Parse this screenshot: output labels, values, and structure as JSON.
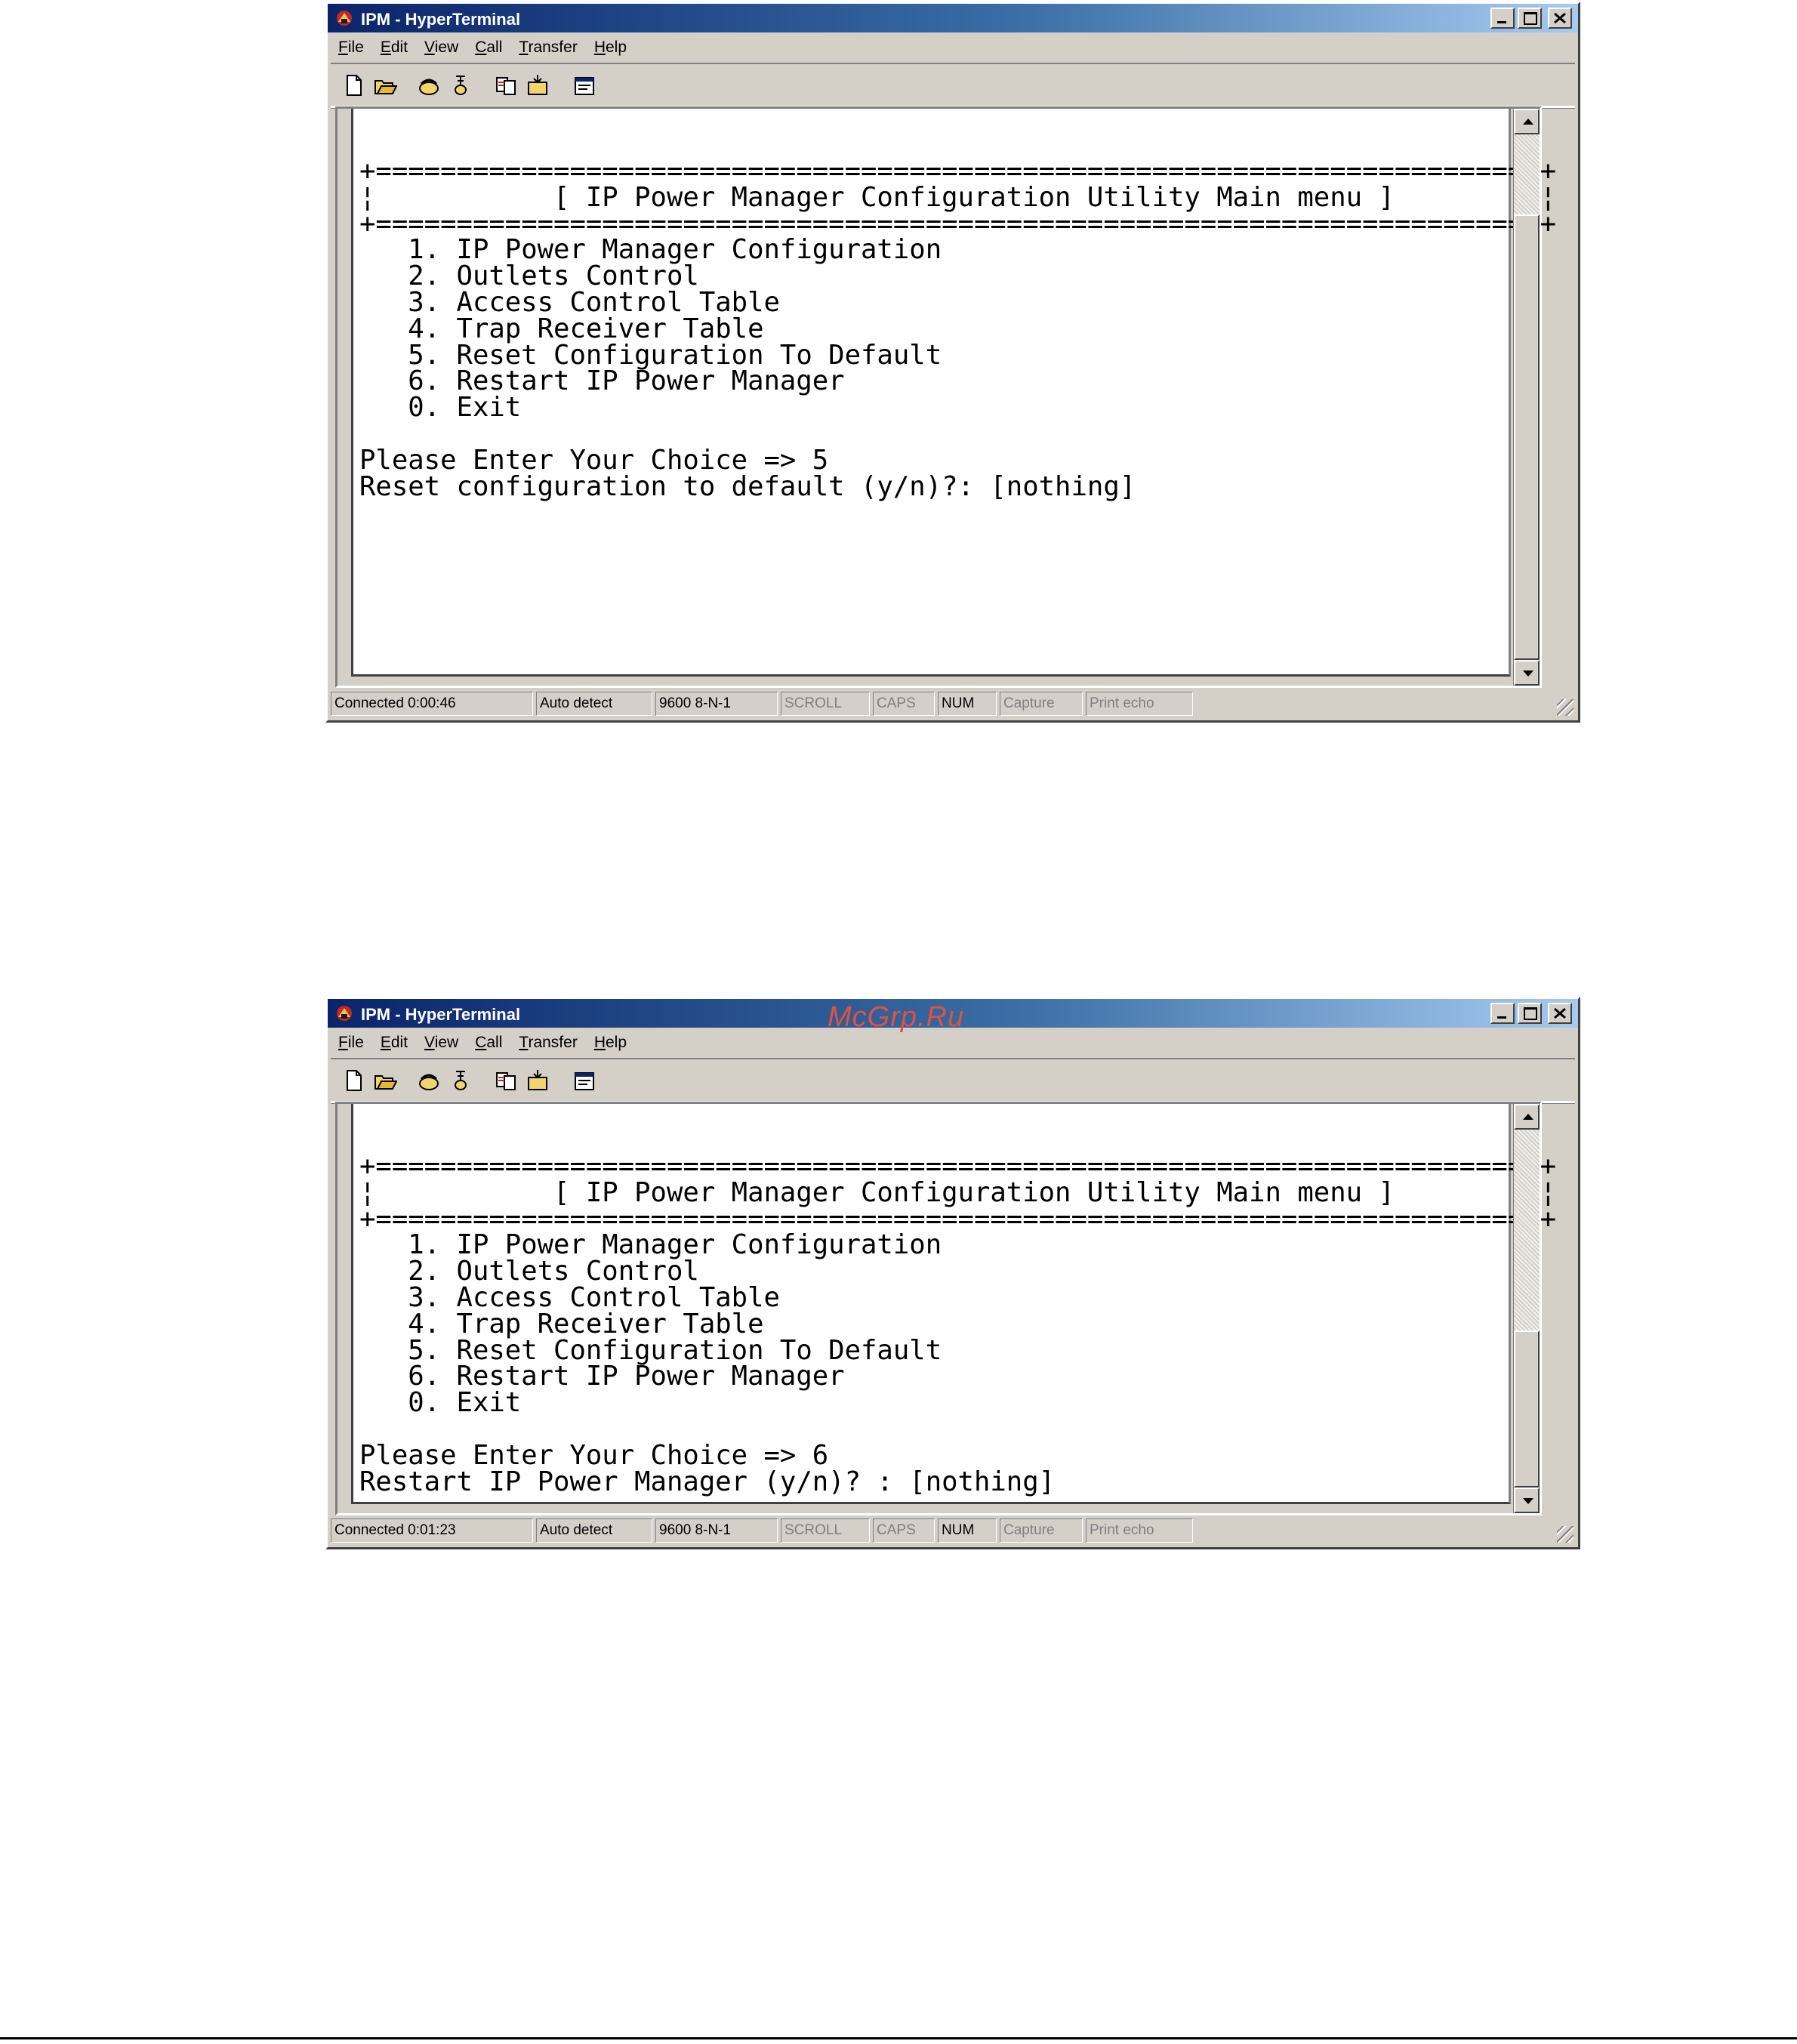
{
  "windows": [
    {
      "title": "IPM - HyperTerminal",
      "menu": [
        {
          "key": "F",
          "rest": "ile"
        },
        {
          "key": "E",
          "rest": "dit"
        },
        {
          "key": "V",
          "rest": "iew"
        },
        {
          "key": "C",
          "rest": "all"
        },
        {
          "key": "T",
          "rest": "ransfer"
        },
        {
          "key": "H",
          "rest": "elp"
        }
      ],
      "terminal_text": "+========================================================================+\n¦           [ IP Power Manager Configuration Utility Main menu ]         ¦\n+========================================================================+\n   1. IP Power Manager Configuration\n   2. Outlets Control\n   3. Access Control Table\n   4. Trap Receiver Table\n   5. Reset Configuration To Default\n   6. Restart IP Power Manager\n   0. Exit\n\nPlease Enter Your Choice => 5\nReset configuration to default (y/n)?: [nothing]",
      "status": {
        "connected": "Connected 0:00:46",
        "detect": "Auto detect",
        "port": "9600 8-N-1",
        "scroll": "SCROLL",
        "caps": "CAPS",
        "num": "NUM",
        "capture": "Capture",
        "print_echo": "Print echo"
      }
    },
    {
      "title": "IPM - HyperTerminal",
      "menu": [
        {
          "key": "F",
          "rest": "ile"
        },
        {
          "key": "E",
          "rest": "dit"
        },
        {
          "key": "V",
          "rest": "iew"
        },
        {
          "key": "C",
          "rest": "all"
        },
        {
          "key": "T",
          "rest": "ransfer"
        },
        {
          "key": "H",
          "rest": "elp"
        }
      ],
      "terminal_text": "+========================================================================+\n¦           [ IP Power Manager Configuration Utility Main menu ]         ¦\n+========================================================================+\n   1. IP Power Manager Configuration\n   2. Outlets Control\n   3. Access Control Table\n   4. Trap Receiver Table\n   5. Reset Configuration To Default\n   6. Restart IP Power Manager\n   0. Exit\n\nPlease Enter Your Choice => 6\nRestart IP Power Manager (y/n)? : [nothing]",
      "status": {
        "connected": "Connected 0:01:23",
        "detect": "Auto detect",
        "port": "9600 8-N-1",
        "scroll": "SCROLL",
        "caps": "CAPS",
        "num": "NUM",
        "capture": "Capture",
        "print_echo": "Print echo"
      }
    }
  ],
  "toolbar_icons": [
    "new-icon",
    "open-icon",
    "connect-icon",
    "disconnect-icon",
    "send-icon",
    "receive-icon",
    "properties-icon"
  ],
  "watermark": "McGrp.Ru",
  "colors": {
    "title_active": "#0a246a",
    "title_gradient_end": "#a6caf0",
    "face": "#d4d0c8",
    "watermark": "#e0523e"
  }
}
